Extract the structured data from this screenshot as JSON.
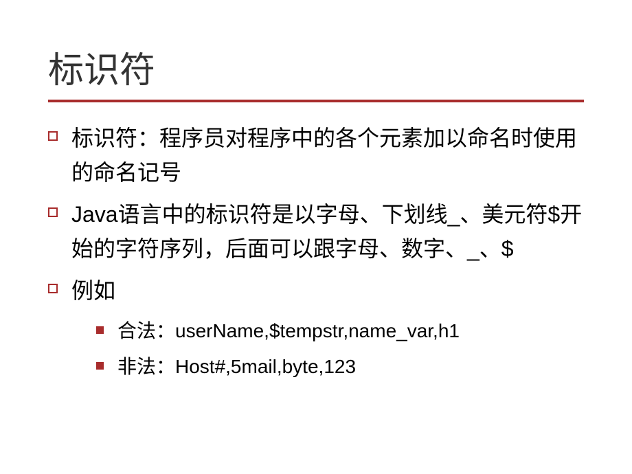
{
  "slide": {
    "title": "标识符",
    "bullets": [
      {
        "text": "标识符：程序员对程序中的各个元素加以命名时使用的命名记号"
      },
      {
        "text": "Java语言中的标识符是以字母、下划线_、美元符$开始的字符序列，后面可以跟字母、数字、_、$"
      },
      {
        "text": "例如",
        "sub": [
          "合法：userName,$tempstr,name_var,h1",
          "非法：Host#,5mail,byte,123"
        ]
      }
    ]
  }
}
